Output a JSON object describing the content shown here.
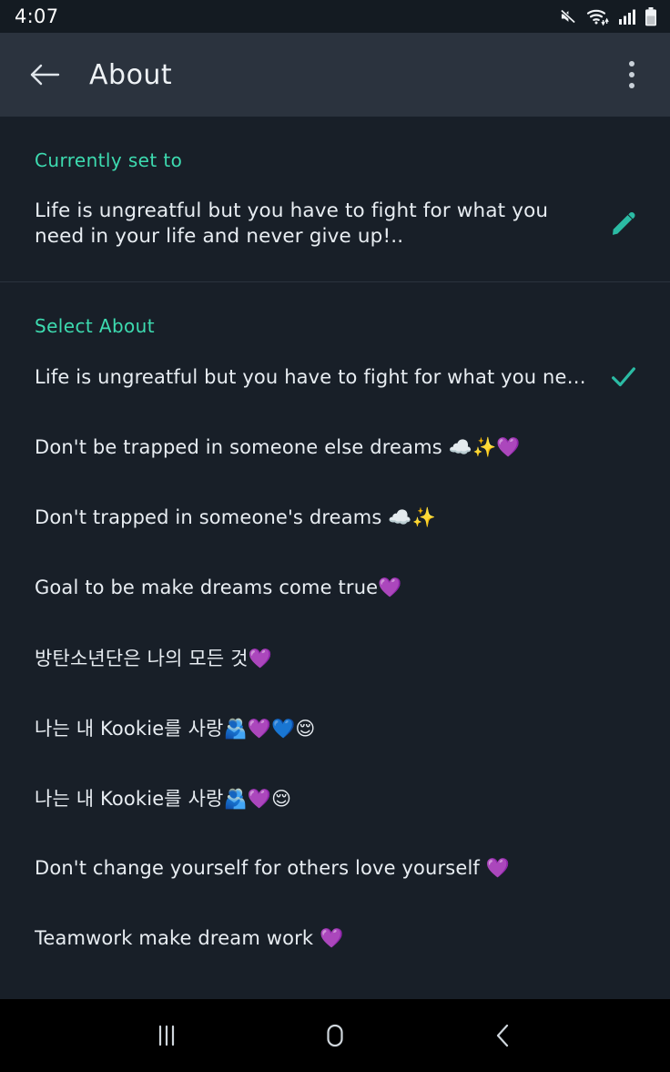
{
  "statusbar": {
    "time": "4:07",
    "icons": [
      "mute-icon",
      "wifi-icon",
      "cellular-signal-icon",
      "battery-icon"
    ]
  },
  "toolbar": {
    "title": "About",
    "back_icon": "arrow-left-icon",
    "overflow_icon": "more-vertical-icon"
  },
  "current": {
    "label": "Currently set to",
    "value": "Life is ungreatful but you have to fight for what you need in your life and never give up!..",
    "edit_icon": "pencil-icon"
  },
  "select": {
    "label": "Select About",
    "check_icon": "check-icon",
    "items": [
      {
        "text": "Life is ungreatful but you have to fight for what you nee…",
        "selected": true
      },
      {
        "text": "Don't be trapped in someone else dreams ☁️✨💜",
        "selected": false
      },
      {
        "text": "Don't trapped in someone's dreams ☁️✨",
        "selected": false
      },
      {
        "text": "Goal to be make dreams come true💜",
        "selected": false
      },
      {
        "text": "방탄소년단은 나의 모든 것💜",
        "selected": false
      },
      {
        "text": "나는 내 Kookie를 사랑🫂💜💙😌",
        "selected": false
      },
      {
        "text": "나는 내 Kookie를 사랑🫂💜😌",
        "selected": false
      },
      {
        "text": "Don't change yourself for others love yourself 💜",
        "selected": false
      },
      {
        "text": "Teamwork make dream work 💜",
        "selected": false
      }
    ]
  },
  "navbar": {
    "recents_icon": "recents-icon",
    "home_icon": "home-icon",
    "back_icon": "back-chevron-icon"
  },
  "colors": {
    "accent": "#3ddbb0",
    "background": "#181f28",
    "toolbar": "#2b333e",
    "statusbar": "#141b22",
    "text": "#e8edf2"
  }
}
